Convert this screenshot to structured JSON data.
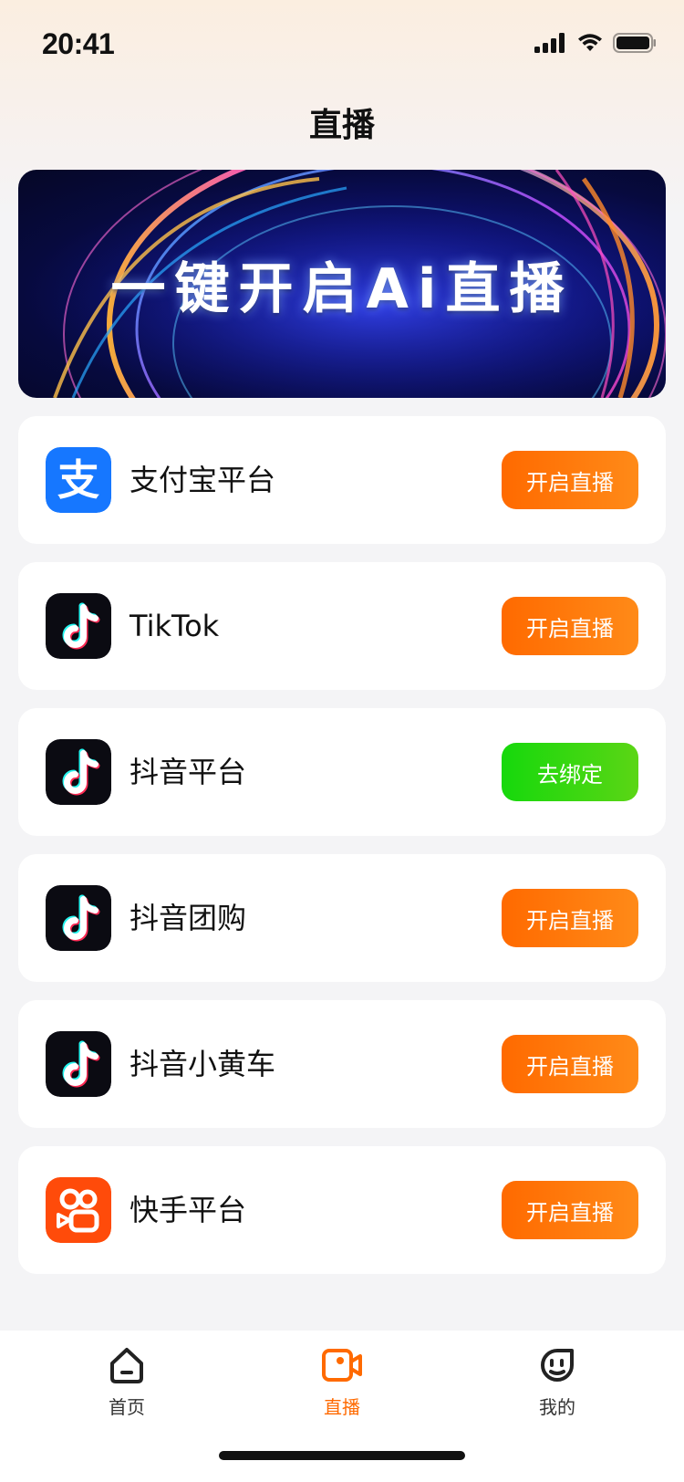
{
  "status_bar": {
    "time": "20:41"
  },
  "header": {
    "title": "直播"
  },
  "banner": {
    "text": "一键开启Ai直播"
  },
  "platforms": [
    {
      "name": "支付宝平台",
      "icon": "alipay-icon",
      "action": "开启直播",
      "action_color": "#ff6a00"
    },
    {
      "name": "TikTok",
      "icon": "tiktok-icon",
      "action": "开启直播",
      "action_color": "#ff6a00"
    },
    {
      "name": "抖音平台",
      "icon": "douyin-icon",
      "action": "去绑定",
      "action_color": "#16d80c"
    },
    {
      "name": "抖音团购",
      "icon": "douyin-icon",
      "action": "开启直播",
      "action_color": "#ff6a00"
    },
    {
      "name": "抖音小黄车",
      "icon": "douyin-icon",
      "action": "开启直播",
      "action_color": "#ff6a00"
    },
    {
      "name": "快手平台",
      "icon": "kuaishou-icon",
      "action": "开启直播",
      "action_color": "#ff6a00"
    }
  ],
  "tabbar": {
    "items": [
      {
        "label": "首页",
        "icon": "home-icon",
        "active": false
      },
      {
        "label": "直播",
        "icon": "video-camera-icon",
        "active": true
      },
      {
        "label": "我的",
        "icon": "face-icon",
        "active": false
      }
    ],
    "active_color": "#ff6a00"
  }
}
